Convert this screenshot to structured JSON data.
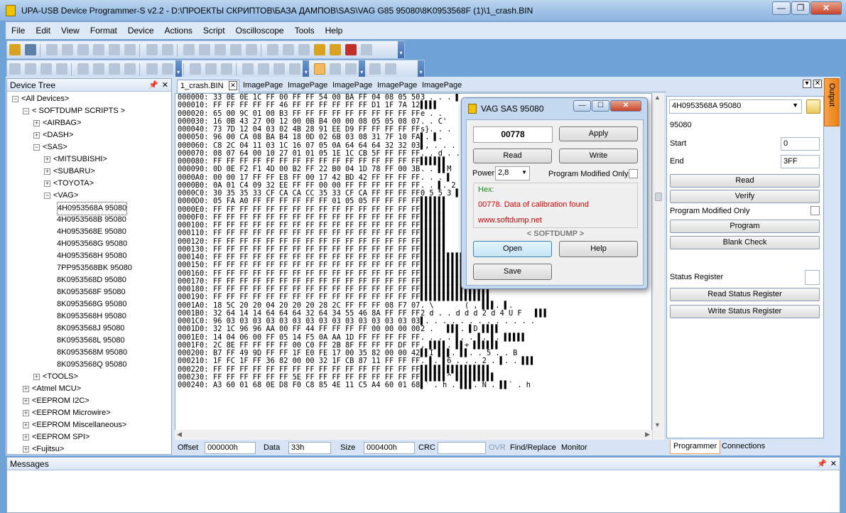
{
  "window": {
    "title": "UPA-USB Device Programmer-S v2.2 - D:\\ПРОЕКТЫ СКРИПТОВ\\БАЗА ДАМПОВ\\SAS\\VAG G85 95080\\8K0953568F (1)\\1_crash.BIN",
    "min": "—",
    "restore": "❐",
    "close": "✕"
  },
  "menu": [
    "File",
    "Edit",
    "View",
    "Format",
    "Device",
    "Actions",
    "Script",
    "Oscilloscope",
    "Tools",
    "Help"
  ],
  "devtree": {
    "title": "Device Tree",
    "pin": "📌",
    "close": "✕",
    "nodes": [
      {
        "label": "<All Devices>",
        "level": 0,
        "exp": "−"
      },
      {
        "label": "< SOFTDUMP SCRIPTS >",
        "level": 1,
        "exp": "−"
      },
      {
        "label": "<AIRBAG>",
        "level": 2,
        "exp": "+"
      },
      {
        "label": "<DASH>",
        "level": 2,
        "exp": "+"
      },
      {
        "label": "<SAS>",
        "level": 2,
        "exp": "−"
      },
      {
        "label": "<MITSUBISHI>",
        "level": 3,
        "exp": "+"
      },
      {
        "label": "<SUBARU>",
        "level": 3,
        "exp": "+"
      },
      {
        "label": "<TOYOTA>",
        "level": 3,
        "exp": "+"
      },
      {
        "label": "<VAG>",
        "level": 3,
        "exp": "−"
      },
      {
        "label": "4H0953568A 95080",
        "level": 4,
        "exp": "",
        "selected": true
      },
      {
        "label": "4H0953568B 95080",
        "level": 4,
        "exp": ""
      },
      {
        "label": "4H0953568E 95080",
        "level": 4,
        "exp": ""
      },
      {
        "label": "4H0953568G 95080",
        "level": 4,
        "exp": ""
      },
      {
        "label": "4H0953568H 95080",
        "level": 4,
        "exp": ""
      },
      {
        "label": "7PP953568BK 95080",
        "level": 4,
        "exp": ""
      },
      {
        "label": "8K0953568D 95080",
        "level": 4,
        "exp": ""
      },
      {
        "label": "8K0953568F 95080",
        "level": 4,
        "exp": ""
      },
      {
        "label": "8K0953568G 95080",
        "level": 4,
        "exp": ""
      },
      {
        "label": "8K0953568H 95080",
        "level": 4,
        "exp": ""
      },
      {
        "label": "8K0953568J 95080",
        "level": 4,
        "exp": ""
      },
      {
        "label": "8K0953568L 95080",
        "level": 4,
        "exp": ""
      },
      {
        "label": "8K0953568M 95080",
        "level": 4,
        "exp": ""
      },
      {
        "label": "8K0953568Q 95080",
        "level": 4,
        "exp": ""
      },
      {
        "label": "<TOOLS>",
        "level": 2,
        "exp": "+"
      },
      {
        "label": "<Atmel MCU>",
        "level": 1,
        "exp": "+"
      },
      {
        "label": "<EEPROM I2C>",
        "level": 1,
        "exp": "+"
      },
      {
        "label": "<EEPROM Microwire>",
        "level": 1,
        "exp": "+"
      },
      {
        "label": "<EEPROM Miscellaneous>",
        "level": 1,
        "exp": "+"
      },
      {
        "label": "<EEPROM SPI>",
        "level": 1,
        "exp": "+"
      },
      {
        "label": "<Fujitsu>",
        "level": 1,
        "exp": "+"
      }
    ]
  },
  "tabs": [
    "1_crash.BIN",
    "ImagePage",
    "ImagePage",
    "ImagePage",
    "ImagePage",
    "ImagePage"
  ],
  "tab_close": "✕",
  "hex": {
    "rows": [
      {
        "a": "000000:",
        "b": "33 0E 0E 1C FF 00 FF FF 54 00 BA FF 04 08 05 50",
        "s": "3 . . . ▌"
      },
      {
        "a": "000010:",
        "b": "FF FF FF FF FF 46 FF FF FF FF FF FF D1 1F 7A 12",
        "s": "▌▌▌▌"
      },
      {
        "a": "000020:",
        "b": "65 00 9C 01 00 B3 FF FF FF FF FF FF FF FF FF FF",
        "s": "e . ."
      },
      {
        "a": "000030:",
        "b": "16 0B 43 27 00 12 00 0B B4 00 00 08 05 05 08 07",
        "s": ". . C'"
      },
      {
        "a": "000040:",
        "b": "73 7D 12 04 03 02 4B 28 91 EE D9 FF FF FF FF FF",
        "s": "s}. . ."
      },
      {
        "a": "000050:",
        "b": "96 00 CA 08 BA B4 18 0D 02 6B 03 08 31 7F 10 FA",
        "s": "▌. ▌."
      },
      {
        "a": "000060:",
        "b": "C8 2C 04 11 03 1C 16 07 05 0A 64 64 64 32 32 03",
        "s": "▌, . . ."
      },
      {
        "a": "000070:",
        "b": "08 07 64 00 10 27 01 01 05 1E 1C CB 5F FF FF FF",
        "s": ". . d . ."
      },
      {
        "a": "000080:",
        "b": "FF FF FF FF FF FF FF FF FF FF FF FF FF FF FF FF",
        "s": "▌▌▌▌▌▌"
      },
      {
        "a": "000090:",
        "b": "0D 0E F2 F1 4D 00 B2 FF 22 B0 04 1D 78 FF 00 3B",
        "s": ". . ▌▌M"
      },
      {
        "a": "0000A0:",
        "b": "00 00 17 FF FF E8 FF 00 17 42 BD 42 FF FF FF FF",
        "s": ". . . ▌"
      },
      {
        "a": "0000B0:",
        "b": "0A 01 C4 09 32 EE FF FF 00 00 FF FF FF FF FF FF",
        "s": ". . ▌. 2"
      },
      {
        "a": "0000C0:",
        "b": "30 35 35 33 CF CA CA CC 35 33 CF CA FF FF FF FF",
        "s": "0 5 5 3 ▌"
      },
      {
        "a": "0000D0:",
        "b": "05 FA A0 FF FF FF FF FF FF 01 05 05 FF FF FF FF",
        "s": "▌▌▌▌▌▌"
      },
      {
        "a": "0000E0:",
        "b": "FF FF FF FF FF FF FF FF FF FF FF FF FF FF FF FF",
        "s": "▌▌▌▌▌▌"
      },
      {
        "a": "0000F0:",
        "b": "FF FF FF FF FF FF FF FF FF FF FF FF FF FF FF FF",
        "s": "▌▌▌▌▌▌"
      },
      {
        "a": "000100:",
        "b": "FF FF FF FF FF FF FF FF FF FF FF FF FF FF FF FF",
        "s": "▌▌▌▌▌▌"
      },
      {
        "a": "000110:",
        "b": "FF FF FF FF FF FF FF FF FF FF FF FF FF FF FF FF",
        "s": "▌▌▌▌▌▌"
      },
      {
        "a": "000120:",
        "b": "FF FF FF FF FF FF FF FF FF FF FF FF FF FF FF FF",
        "s": "▌▌▌▌▌▌"
      },
      {
        "a": "000130:",
        "b": "FF FF FF FF FF FF FF FF FF FF FF FF FF FF FF FF",
        "s": "▌▌▌▌▌▌"
      },
      {
        "a": "000140:",
        "b": "FF FF FF FF FF FF FF FF FF FF FF FF FF FF FF FF",
        "s": "▌▌▌▌▌▌▌▌▌▌▌▌▌▌▌▌"
      },
      {
        "a": "000150:",
        "b": "FF FF FF FF FF FF FF FF FF FF FF FF FF FF FF FF",
        "s": "▌▌▌▌▌▌▌▌▌▌▌▌▌▌▌▌"
      },
      {
        "a": "000160:",
        "b": "FF FF FF FF FF FF FF FF FF FF FF FF FF FF FF FF",
        "s": "▌▌▌▌▌▌▌▌▌▌▌▌▌▌▌▌"
      },
      {
        "a": "000170:",
        "b": "FF FF FF FF FF FF FF FF FF FF FF FF FF FF FF FF",
        "s": "▌▌▌▌▌▌▌▌▌▌▌▌▌▌▌▌"
      },
      {
        "a": "000180:",
        "b": "FF FF FF FF FF FF FF FF FF FF FF FF FF FF FF FF",
        "s": "▌▌▌▌▌▌▌▌▌▌▌▌▌▌▌▌"
      },
      {
        "a": "000190:",
        "b": "FF FF FF FF FF FF FF FF FF FF FF FF FF FF FF FF",
        "s": "▌▌▌▌▌▌▌▌▌▌▌▌▌▌▌▌"
      },
      {
        "a": "0001A0:",
        "b": "18 5C 20 20 04 20 20 20 28 2C FF FF FF 08 F7 07",
        "s": ". \\       ( , ▌▌▌. ▌."
      },
      {
        "a": "0001B0:",
        "b": "32 64 14 14 64 64 64 32 64 34 55 46 8A FF FF FF",
        "s": "2 d . . d d d 2 d 4 U F   ▌▌▌"
      },
      {
        "a": "0001C0:",
        "b": "96 03 03 03 03 03 03 03 03 03 03 03 03 03 03 03",
        "s": "▌. . . . . . . . . . . . ."
      },
      {
        "a": "0001D0:",
        "b": "32 1C 96 96 AA 00 FF 44 FF FF FF FF 00 00 00 00",
        "s": "2 .   ▌▌▌. ▌D ▌▌▌▌"
      },
      {
        "a": "0001E0:",
        "b": "14 04 06 00 FF 05 14 F5 0A AA 1D FF FF FF FF FF",
        "s": ". . . . ▌. . ▌. ▌. ▌▌▌▌▌"
      },
      {
        "a": "0001F0:",
        "b": "2C 8E FF FF FF FF 00 C0 FF 2B 8F FF FF FF DF FF",
        "s": ", ▌▌▌▌. ▌▌+ ▌▌▌▌▌▌"
      },
      {
        "a": "000200:",
        "b": "B7 FF 49 9D FF FF 1F E0 FE 17 00 35 82 00 00 42",
        "s": "▌▌I ▌▌▌. ▌▌. . 5 . . B"
      },
      {
        "a": "000210:",
        "b": "1F FC 1F FF 36 82 00 00 32 1F CB 87 11 FF FF FF",
        "s": ". ▌. ▌6 . . . 2 . ▌. . ▌▌▌"
      },
      {
        "a": "000220:",
        "b": "FF FF FF FF FF FF FF FF FF FF FF FF FF FF FF FF",
        "s": "▌▌▌▌▌▌▌▌▌▌▌▌▌▌▌▌"
      },
      {
        "a": "000230:",
        "b": "FF FF FF FF FF FF 5E FF FF FF FF FF FF FF FF FF",
        "s": "▌▌▌▌▌▌^ ▌▌▌▌▌▌▌▌▌"
      },
      {
        "a": "000240:",
        "b": "A3 60 01 68 0E D8 F0 C8 85 4E 11 C5 A4 60 01 68",
        "s": "▌` . h . ▌▌▌. N . ▌▌` . h"
      }
    ]
  },
  "status": {
    "offset_label": "Offset",
    "offset": "000000h",
    "data_label": "Data",
    "data": "33h",
    "size_label": "Size",
    "size": "000400h",
    "crc_label": "CRC",
    "crc": "",
    "ovr": "OVR",
    "find": "Find/Replace",
    "monitor": "Monitor"
  },
  "rpanel": {
    "device": "4H0953568A 95080",
    "chip": "95080",
    "start_label": "Start",
    "start": "0",
    "end_label": "End",
    "end": "3FF",
    "read": "Read",
    "verify": "Verify",
    "pmo": "Program Modified Only",
    "program": "Program",
    "blank": "Blank Check",
    "status_reg": "Status Register",
    "read_sr": "Read Status Register",
    "write_sr": "Write Status Register",
    "pin": "▾",
    "close": "✕"
  },
  "rtabs": {
    "programmer": "Programmer",
    "connections": "Connections"
  },
  "output_tab": "Output",
  "messages": {
    "title": "Messages",
    "pin": "📌",
    "close": "✕"
  },
  "dialog": {
    "title": "VAG SAS 95080",
    "code": "00778",
    "apply": "Apply",
    "read": "Read",
    "write": "Write",
    "power_label": "Power",
    "power": "2,8",
    "pmo": "Program Modified Only",
    "hex_label": "Hex:",
    "result": "00778. Data of calibration found",
    "url": "www.softdump.net",
    "brand": "< SOFTDUMP >",
    "open": "Open",
    "help": "Help",
    "save": "Save",
    "min": "—",
    "max": "☐",
    "close": "✕"
  },
  "colors": {
    "result": "#d10000",
    "hex_label": "#1a8a1a",
    "url": "#c00000",
    "tab_active": "#ffffff",
    "output": "#f29a3a"
  }
}
